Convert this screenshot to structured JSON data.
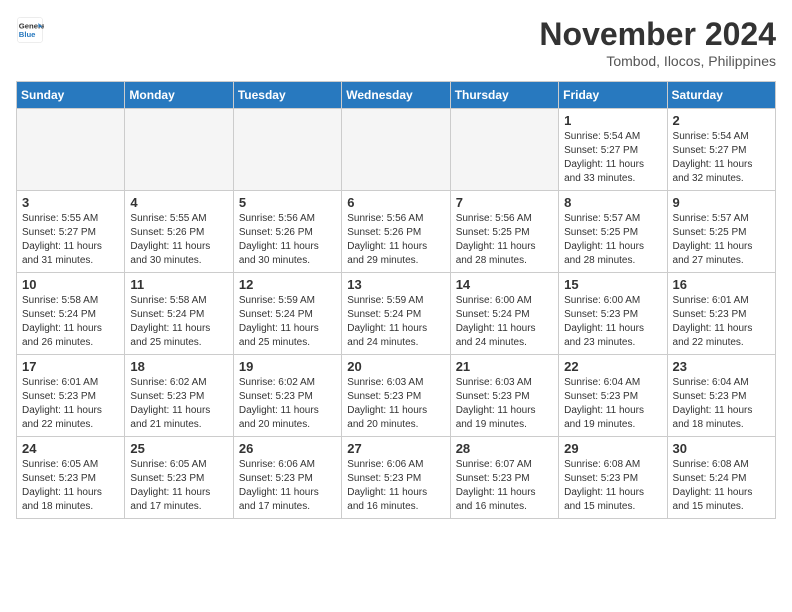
{
  "header": {
    "logo_line1": "General",
    "logo_line2": "Blue",
    "month": "November 2024",
    "location": "Tombod, Ilocos, Philippines"
  },
  "weekdays": [
    "Sunday",
    "Monday",
    "Tuesday",
    "Wednesday",
    "Thursday",
    "Friday",
    "Saturday"
  ],
  "weeks": [
    [
      {
        "day": "",
        "info": ""
      },
      {
        "day": "",
        "info": ""
      },
      {
        "day": "",
        "info": ""
      },
      {
        "day": "",
        "info": ""
      },
      {
        "day": "",
        "info": ""
      },
      {
        "day": "1",
        "info": "Sunrise: 5:54 AM\nSunset: 5:27 PM\nDaylight: 11 hours\nand 33 minutes."
      },
      {
        "day": "2",
        "info": "Sunrise: 5:54 AM\nSunset: 5:27 PM\nDaylight: 11 hours\nand 32 minutes."
      }
    ],
    [
      {
        "day": "3",
        "info": "Sunrise: 5:55 AM\nSunset: 5:27 PM\nDaylight: 11 hours\nand 31 minutes."
      },
      {
        "day": "4",
        "info": "Sunrise: 5:55 AM\nSunset: 5:26 PM\nDaylight: 11 hours\nand 30 minutes."
      },
      {
        "day": "5",
        "info": "Sunrise: 5:56 AM\nSunset: 5:26 PM\nDaylight: 11 hours\nand 30 minutes."
      },
      {
        "day": "6",
        "info": "Sunrise: 5:56 AM\nSunset: 5:26 PM\nDaylight: 11 hours\nand 29 minutes."
      },
      {
        "day": "7",
        "info": "Sunrise: 5:56 AM\nSunset: 5:25 PM\nDaylight: 11 hours\nand 28 minutes."
      },
      {
        "day": "8",
        "info": "Sunrise: 5:57 AM\nSunset: 5:25 PM\nDaylight: 11 hours\nand 28 minutes."
      },
      {
        "day": "9",
        "info": "Sunrise: 5:57 AM\nSunset: 5:25 PM\nDaylight: 11 hours\nand 27 minutes."
      }
    ],
    [
      {
        "day": "10",
        "info": "Sunrise: 5:58 AM\nSunset: 5:24 PM\nDaylight: 11 hours\nand 26 minutes."
      },
      {
        "day": "11",
        "info": "Sunrise: 5:58 AM\nSunset: 5:24 PM\nDaylight: 11 hours\nand 25 minutes."
      },
      {
        "day": "12",
        "info": "Sunrise: 5:59 AM\nSunset: 5:24 PM\nDaylight: 11 hours\nand 25 minutes."
      },
      {
        "day": "13",
        "info": "Sunrise: 5:59 AM\nSunset: 5:24 PM\nDaylight: 11 hours\nand 24 minutes."
      },
      {
        "day": "14",
        "info": "Sunrise: 6:00 AM\nSunset: 5:24 PM\nDaylight: 11 hours\nand 24 minutes."
      },
      {
        "day": "15",
        "info": "Sunrise: 6:00 AM\nSunset: 5:23 PM\nDaylight: 11 hours\nand 23 minutes."
      },
      {
        "day": "16",
        "info": "Sunrise: 6:01 AM\nSunset: 5:23 PM\nDaylight: 11 hours\nand 22 minutes."
      }
    ],
    [
      {
        "day": "17",
        "info": "Sunrise: 6:01 AM\nSunset: 5:23 PM\nDaylight: 11 hours\nand 22 minutes."
      },
      {
        "day": "18",
        "info": "Sunrise: 6:02 AM\nSunset: 5:23 PM\nDaylight: 11 hours\nand 21 minutes."
      },
      {
        "day": "19",
        "info": "Sunrise: 6:02 AM\nSunset: 5:23 PM\nDaylight: 11 hours\nand 20 minutes."
      },
      {
        "day": "20",
        "info": "Sunrise: 6:03 AM\nSunset: 5:23 PM\nDaylight: 11 hours\nand 20 minutes."
      },
      {
        "day": "21",
        "info": "Sunrise: 6:03 AM\nSunset: 5:23 PM\nDaylight: 11 hours\nand 19 minutes."
      },
      {
        "day": "22",
        "info": "Sunrise: 6:04 AM\nSunset: 5:23 PM\nDaylight: 11 hours\nand 19 minutes."
      },
      {
        "day": "23",
        "info": "Sunrise: 6:04 AM\nSunset: 5:23 PM\nDaylight: 11 hours\nand 18 minutes."
      }
    ],
    [
      {
        "day": "24",
        "info": "Sunrise: 6:05 AM\nSunset: 5:23 PM\nDaylight: 11 hours\nand 18 minutes."
      },
      {
        "day": "25",
        "info": "Sunrise: 6:05 AM\nSunset: 5:23 PM\nDaylight: 11 hours\nand 17 minutes."
      },
      {
        "day": "26",
        "info": "Sunrise: 6:06 AM\nSunset: 5:23 PM\nDaylight: 11 hours\nand 17 minutes."
      },
      {
        "day": "27",
        "info": "Sunrise: 6:06 AM\nSunset: 5:23 PM\nDaylight: 11 hours\nand 16 minutes."
      },
      {
        "day": "28",
        "info": "Sunrise: 6:07 AM\nSunset: 5:23 PM\nDaylight: 11 hours\nand 16 minutes."
      },
      {
        "day": "29",
        "info": "Sunrise: 6:08 AM\nSunset: 5:23 PM\nDaylight: 11 hours\nand 15 minutes."
      },
      {
        "day": "30",
        "info": "Sunrise: 6:08 AM\nSunset: 5:24 PM\nDaylight: 11 hours\nand 15 minutes."
      }
    ]
  ]
}
